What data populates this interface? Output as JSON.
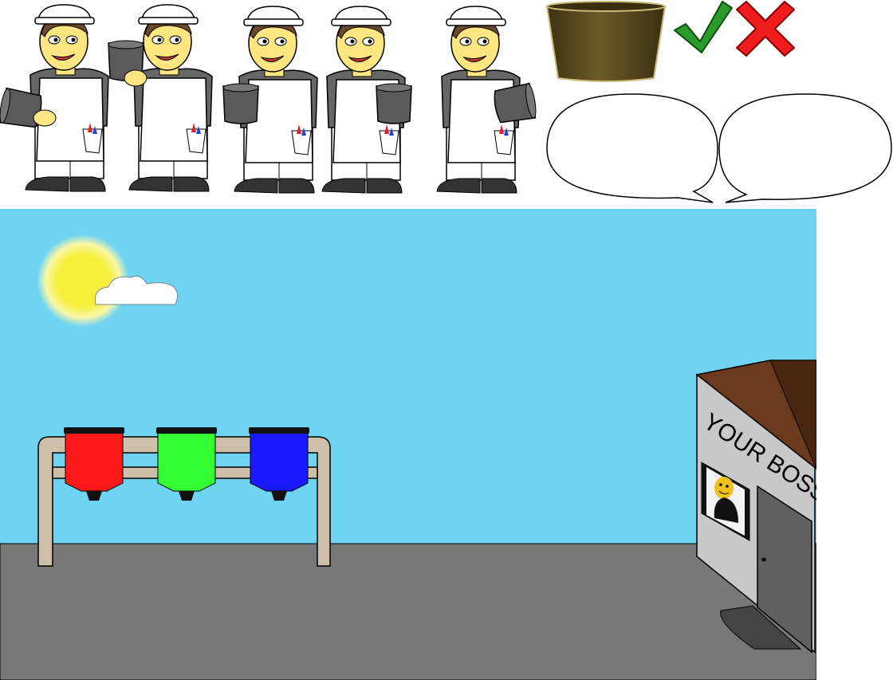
{
  "sprites": {
    "workers": [
      {
        "pose": "bucket-left"
      },
      {
        "pose": "bucket-raised-left"
      },
      {
        "pose": "bucket-front-left"
      },
      {
        "pose": "bucket-front-right"
      },
      {
        "pose": "bucket-right"
      }
    ],
    "icons": [
      "mixing-tub-icon",
      "check-icon",
      "cross-icon"
    ],
    "speech_bubbles": 2
  },
  "scene": {
    "sign_text": "YOUR BOSS",
    "paint_buckets": [
      {
        "name": "red",
        "color": "#ff1a1a"
      },
      {
        "name": "green",
        "color": "#33ff33"
      },
      {
        "name": "blue",
        "color": "#1a1aff"
      }
    ],
    "colors": {
      "sky": "#6fd4f2",
      "ground": "#787878",
      "rack": "#cdbfaa",
      "roof": "#6b3a1c",
      "hut_wall": "#c8c8c8",
      "sun": "#f5ef3a"
    }
  }
}
